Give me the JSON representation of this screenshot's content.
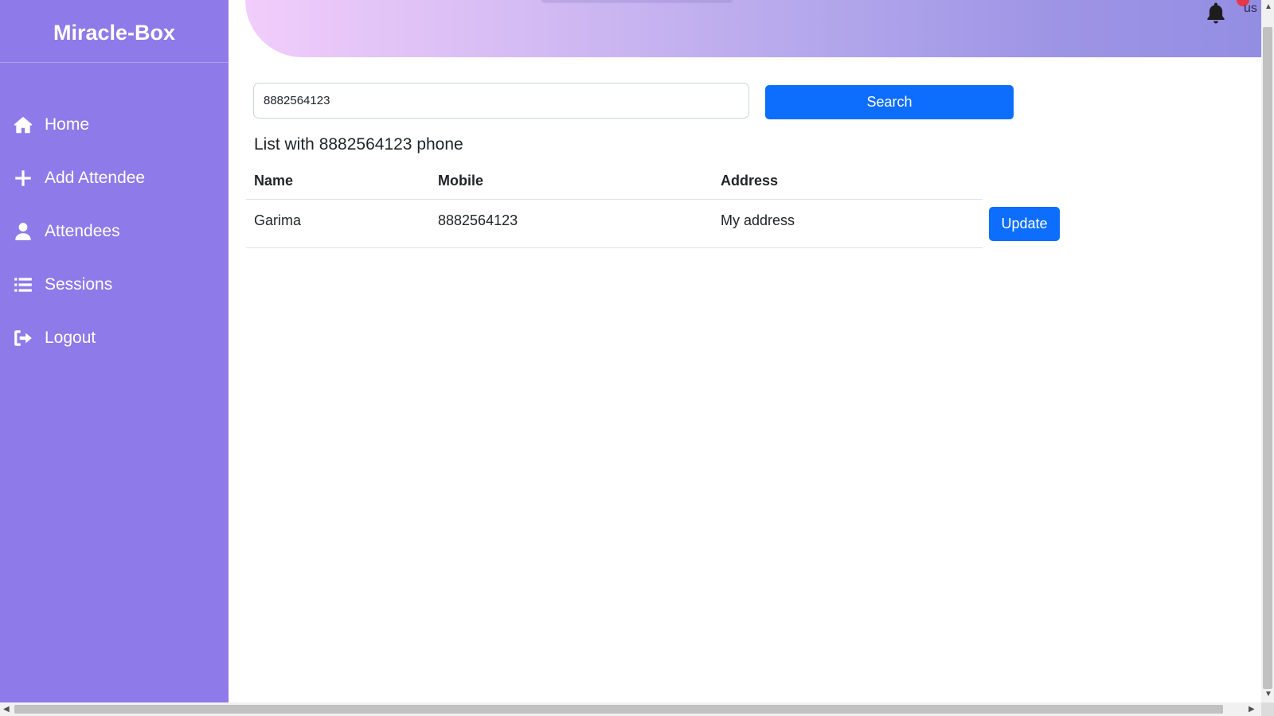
{
  "app": {
    "brand": "Miracle-Box"
  },
  "sidebar": {
    "items": [
      {
        "label": "Home",
        "icon": "home-icon"
      },
      {
        "label": "Add Attendee",
        "icon": "plus-icon"
      },
      {
        "label": "Attendees",
        "icon": "user-icon"
      },
      {
        "label": "Sessions",
        "icon": "list-icon"
      },
      {
        "label": "Logout",
        "icon": "logout-icon"
      }
    ]
  },
  "header": {
    "user_text": "us",
    "notification_icon": "bell-icon"
  },
  "search": {
    "value": "8882564123",
    "button_label": "Search"
  },
  "results": {
    "title": "List with 8882564123 phone",
    "columns": [
      "Name",
      "Mobile",
      "Address"
    ],
    "rows": [
      {
        "name": "Garima",
        "mobile": "8882564123",
        "address": "My address",
        "action_label": "Update"
      }
    ]
  },
  "colors": {
    "sidebar": "#8e7ae8",
    "primary_button": "#0d6efd",
    "header_gradient_start": "#f1cdfb",
    "header_gradient_end": "#948ee3"
  }
}
